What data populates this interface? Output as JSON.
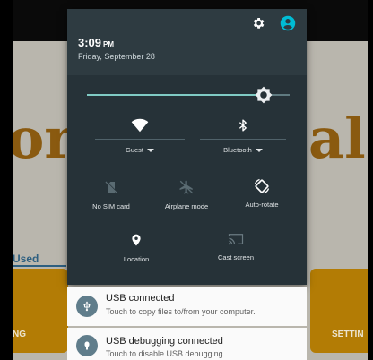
{
  "background_app": {
    "logo_left": "or",
    "logo_right": "al",
    "tab_used": "Used",
    "tile_left_label": "NG",
    "tile_right_label": "SETTIN"
  },
  "header": {
    "time": "3:09",
    "ampm": "PM",
    "date": "Friday, September 28",
    "settings_icon": "gear-icon",
    "account_icon": "account-circle-icon",
    "accent_color": "#00bcd4"
  },
  "brightness": {
    "level": 0.87,
    "icon": "brightness-icon",
    "track_color": "#80cbc4"
  },
  "quick_settings": {
    "wifi": {
      "label": "Guest",
      "icon": "wifi-icon",
      "has_dropdown": true
    },
    "bluetooth": {
      "label": "Bluetooth",
      "icon": "bluetooth-icon",
      "has_dropdown": true
    },
    "sim": {
      "label": "No SIM card",
      "icon": "no-sim-icon"
    },
    "airplane": {
      "label": "Airplane mode",
      "icon": "airplane-icon"
    },
    "autorotate": {
      "label": "Auto-rotate",
      "icon": "auto-rotate-icon"
    },
    "location": {
      "label": "Location",
      "icon": "location-pin-icon"
    },
    "cast": {
      "label": "Cast screen",
      "icon": "cast-icon"
    }
  },
  "notifications": [
    {
      "title": "USB connected",
      "body": "Touch to copy files to/from your computer.",
      "icon": "usb-icon"
    },
    {
      "title": "USB debugging connected",
      "body": "Touch to disable USB debugging.",
      "icon": "debug-bug-icon"
    }
  ]
}
